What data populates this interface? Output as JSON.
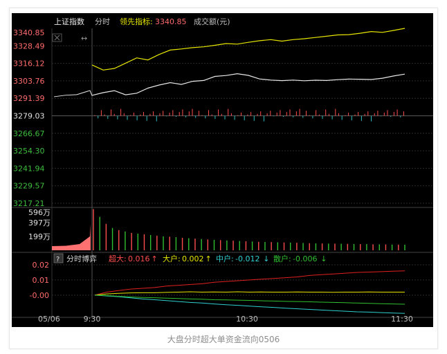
{
  "caption": "大盘分时超大单资金流向0506",
  "header": {
    "index_name": "上证指数",
    "mode": "分时",
    "leading_label": "领先指标:",
    "leading_value": "3340.85",
    "volume_label": "成交额(元)"
  },
  "colors": {
    "up": "#ff4d4d",
    "down": "#2ec0c0",
    "green_axis": "#3cbd3c",
    "index_line": "#e8e8e8",
    "leading_line": "#e6e600",
    "grid": "#2a2a2a",
    "super_large": "#e02020",
    "large": "#e6e600",
    "medium": "#30d0d0",
    "small": "#30c030"
  },
  "chart_data": [
    {
      "type": "line",
      "title": "上证指数 分时",
      "x_ticks": [
        "05/06",
        "9:30",
        "10:30",
        "11:30"
      ],
      "y_ticks": [
        3340.85,
        3328.49,
        3316.12,
        3303.76,
        3291.39,
        3279.03,
        3266.67,
        3254.3,
        3241.94,
        3229.57,
        3217.21
      ],
      "ylim": [
        3217.21,
        3340.85
      ],
      "prev_close": 3279.03,
      "series": [
        {
          "name": "上证指数",
          "color": "index",
          "values": [
            3293.5,
            3295.4,
            3296.8,
            3293.9,
            3295.0,
            3298.6,
            3300.8,
            3302.5,
            3301.2,
            3303.4,
            3304.0,
            3306.9,
            3307.5,
            3308.8,
            3307.6,
            3305.1,
            3304.3,
            3303.9,
            3304.3,
            3303.8,
            3304.2,
            3304.0,
            3304.6,
            3305.0,
            3304.9,
            3304.7,
            3305.6,
            3307.2,
            3308.5
          ]
        },
        {
          "name": "领先指标",
          "color": "leading",
          "values": [
            3315.0,
            3311.4,
            3312.5,
            3316.2,
            3320.0,
            3318.5,
            3322.4,
            3325.5,
            3326.3,
            3327.2,
            3327.8,
            3328.9,
            3330.1,
            3329.7,
            3331.0,
            3332.1,
            3332.9,
            3331.8,
            3332.9,
            3333.5,
            3334.4,
            3335.3,
            3336.2,
            3336.4,
            3337.4,
            3338.6,
            3338.0,
            3339.4,
            3340.85
          ]
        }
      ]
    },
    {
      "type": "bar",
      "title": "成交额(元)",
      "y_ticks": [
        "596万",
        "397万",
        "199万"
      ],
      "ylim": [
        0,
        596
      ],
      "values": [
        592,
        480,
        380,
        320,
        290,
        270,
        250,
        240,
        230,
        220,
        210,
        200,
        195,
        188,
        180,
        174,
        168,
        162,
        156,
        150,
        146,
        142,
        138,
        134,
        130,
        126,
        122,
        120,
        118,
        115,
        112,
        110,
        108,
        105,
        102,
        100,
        98,
        96,
        95,
        94,
        92,
        90,
        89,
        88,
        86,
        85,
        84,
        82,
        81,
        80
      ]
    },
    {
      "type": "line",
      "title": "分时博弈",
      "legend": [
        {
          "label": "超大:",
          "value": "0.016",
          "arrow": "↑",
          "color": "super_large"
        },
        {
          "label": "大户:",
          "value": "0.002",
          "arrow": "↑",
          "color": "large"
        },
        {
          "label": "中户:",
          "value": "-0.012",
          "arrow": "↓",
          "color": "medium"
        },
        {
          "label": "散户:",
          "value": "-0.006",
          "arrow": "↓",
          "color": "small"
        }
      ],
      "y_ticks": [
        "0.02",
        "0.01",
        "-0.00"
      ],
      "ylim": [
        -0.011,
        0.02
      ],
      "series": [
        {
          "name": "超大",
          "color": "super_large",
          "values": [
            0.0,
            0.002,
            0.003,
            0.004,
            0.0045,
            0.005,
            0.006,
            0.0065,
            0.007,
            0.0075,
            0.0085,
            0.009,
            0.0095,
            0.01,
            0.0105,
            0.011,
            0.0115,
            0.012,
            0.013,
            0.0135,
            0.014,
            0.0145,
            0.015,
            0.0152,
            0.0155,
            0.0158,
            0.016
          ]
        },
        {
          "name": "大户",
          "color": "large",
          "values": [
            0.0,
            0.0008,
            0.0012,
            0.0015,
            0.0016,
            0.0016,
            0.0018,
            0.002,
            0.0022,
            0.002,
            0.0021,
            0.002,
            0.0022,
            0.002,
            0.0021,
            0.002,
            0.002,
            0.0021,
            0.002,
            0.002,
            0.0019,
            0.002,
            0.002,
            0.0021,
            0.002,
            0.002,
            0.002
          ]
        },
        {
          "name": "中户",
          "color": "medium",
          "values": [
            0.0,
            -0.0005,
            -0.001,
            -0.0018,
            -0.0025,
            -0.003,
            -0.0036,
            -0.0042,
            -0.0048,
            -0.0052,
            -0.0058,
            -0.0063,
            -0.0067,
            -0.0072,
            -0.0077,
            -0.0081,
            -0.0086,
            -0.009,
            -0.0094,
            -0.0098,
            -0.0102,
            -0.0106,
            -0.011,
            -0.0112,
            -0.0115,
            -0.0118,
            -0.012
          ]
        },
        {
          "name": "散户",
          "color": "small",
          "values": [
            0.0,
            -0.0003,
            -0.0008,
            -0.0012,
            -0.0015,
            -0.0017,
            -0.002,
            -0.0022,
            -0.0025,
            -0.0027,
            -0.003,
            -0.0031,
            -0.0033,
            -0.0035,
            -0.0037,
            -0.0039,
            -0.0041,
            -0.0042,
            -0.0044,
            -0.0046,
            -0.0048,
            -0.005,
            -0.0052,
            -0.0054,
            -0.0056,
            -0.0058,
            -0.006
          ]
        }
      ]
    }
  ]
}
